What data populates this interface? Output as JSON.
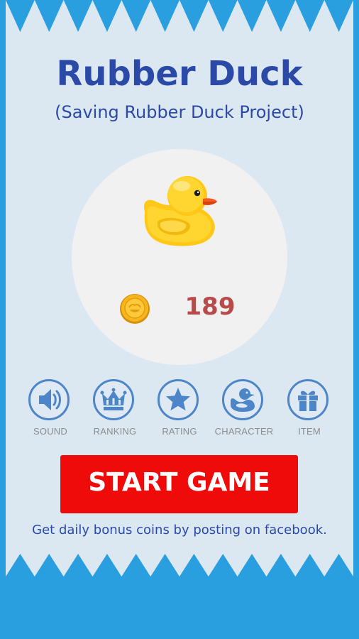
{
  "game": {
    "title": "Rubber Duck",
    "subtitle": "(Saving Rubber Duck Project)",
    "coins": "189",
    "facebook_note": "Get daily bonus coins by posting on facebook."
  },
  "menu": [
    {
      "id": "sound",
      "label": "SOUND",
      "icon": "speaker-icon"
    },
    {
      "id": "ranking",
      "label": "RANKING",
      "icon": "crown-icon"
    },
    {
      "id": "rating",
      "label": "RATING",
      "icon": "star-icon"
    },
    {
      "id": "character",
      "label": "CHARACTER",
      "icon": "duck-icon"
    },
    {
      "id": "item",
      "label": "ITEM",
      "icon": "gift-icon"
    }
  ],
  "start": {
    "label": "START GAME"
  },
  "colors": {
    "background": "#2a9fe0",
    "card": "#dce8f1",
    "title": "#2b4aa8",
    "icon_blue": "#4d86c8",
    "coin_count": "#b94a4a",
    "start_button": "#f00b0b",
    "duck_yellow": "#ffd21a"
  }
}
